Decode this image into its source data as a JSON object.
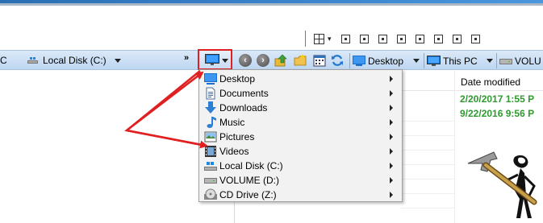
{
  "toolbar": {
    "view_chevron": "▾"
  },
  "address_left": {
    "crumb_partial": "C",
    "drive_label": "Local Disk (C:)",
    "more_chevron": "»"
  },
  "address_right": {
    "locations": [
      {
        "label": "Desktop"
      },
      {
        "label": "This PC"
      },
      {
        "label": "VOLU"
      }
    ]
  },
  "file_list": {
    "column_date": "Date modified",
    "rows": [
      {
        "date": "2/20/2017 1:55 P"
      },
      {
        "date": "9/22/2016 9:56 P"
      }
    ]
  },
  "menu": {
    "items": [
      {
        "label": "Desktop",
        "icon": "desktop-icon"
      },
      {
        "label": "Documents",
        "icon": "documents-icon"
      },
      {
        "label": "Downloads",
        "icon": "downloads-icon"
      },
      {
        "label": "Music",
        "icon": "music-icon"
      },
      {
        "label": "Pictures",
        "icon": "pictures-icon"
      },
      {
        "label": "Videos",
        "icon": "videos-icon"
      },
      {
        "label": "Local Disk (C:)",
        "icon": "local-disk-icon"
      },
      {
        "label": "VOLUME (D:)",
        "icon": "volume-drive-icon"
      },
      {
        "label": "CD Drive (Z:)",
        "icon": "cd-drive-icon"
      }
    ]
  },
  "colors": {
    "highlight_border": "#e02020",
    "annotation_arrow": "#e02020",
    "date_text": "#2e9a2e",
    "address_bar": "#c6dbf3"
  }
}
